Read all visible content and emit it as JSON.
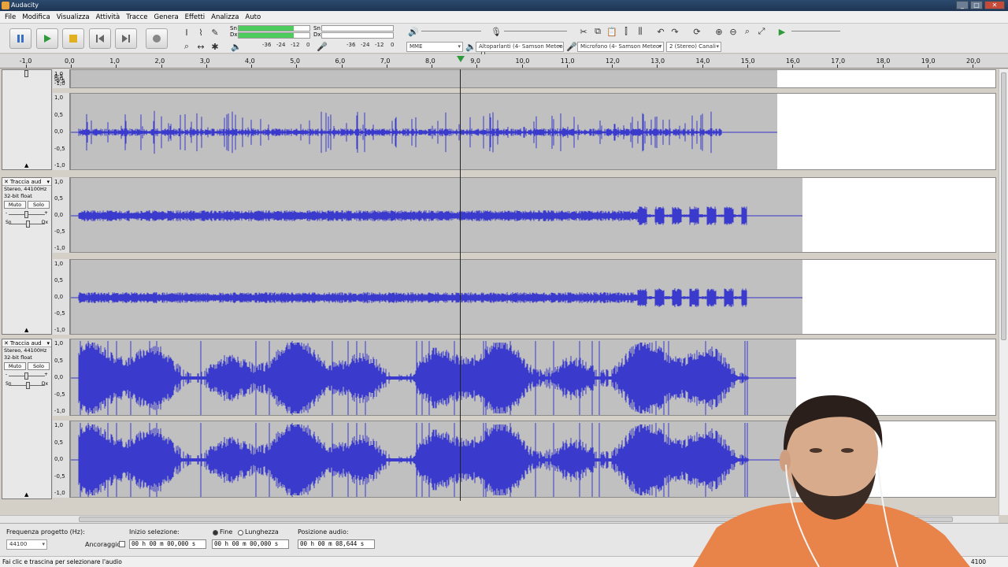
{
  "window": {
    "title": "Audacity"
  },
  "menu": [
    "File",
    "Modifica",
    "Visualizza",
    "Attività",
    "Tracce",
    "Genera",
    "Effetti",
    "Analizza",
    "Auto"
  ],
  "toolbar": {
    "meter_labels": [
      "Sn",
      "Dx",
      "Sn",
      "Dx"
    ],
    "meter_scale_play": [
      "-36",
      "-24",
      "-12",
      "0"
    ],
    "meter_scale_rec": [
      "-36",
      "-24",
      "-12",
      "0"
    ],
    "host": "MME",
    "output_device": "Altoparlanti (4- Samson Meteor",
    "input_device": "Microfono (4- Samson Meteor",
    "channels": "2 (Stereo) Canali"
  },
  "ruler": {
    "ticks": [
      "-1,0",
      "0,0",
      "1,0",
      "2,0",
      "3,0",
      "4,0",
      "5,0",
      "6,0",
      "7,0",
      "8,0",
      "9,0",
      "10,0",
      "11,0",
      "12,0",
      "13,0",
      "14,0",
      "15,0",
      "16,0",
      "17,0",
      "18,0",
      "19,0",
      "20,0"
    ]
  },
  "amp_ticks": [
    "1,0",
    "0,5",
    "0,0",
    "-0,5",
    "-1,0"
  ],
  "tracks": [
    {
      "name": "Traccia aud",
      "info1": "Stereo, 44100Hz",
      "info2": "32-bit float",
      "mute": "Muto",
      "solo": "Solo",
      "gain_left": "-",
      "gain_right": "+",
      "pan_left": "Sn",
      "pan_right": "Dx"
    },
    {
      "name": "Traccia aud",
      "info1": "Stereo, 44100Hz",
      "info2": "32-bit float",
      "mute": "Muto",
      "solo": "Solo",
      "gain_left": "-",
      "gain_right": "+",
      "pan_left": "Sn",
      "pan_right": "Dx"
    }
  ],
  "selection": {
    "rate_label": "Frequenza progetto (Hz):",
    "rate_value": "44100",
    "snap_label": "Ancoraggio",
    "start_label": "Inizio selezione:",
    "end_label": "Fine",
    "length_label": "Lunghezza",
    "position_label": "Posizione audio:",
    "start_value": "00 h 00 m 00,000 s",
    "end_value": "00 h 00 m 00,000 s",
    "position_value": "00 h 00 m 08,644 s"
  },
  "status": {
    "text": "Fai clic e trascina per selezionare l'audio",
    "right": "4100"
  },
  "colors": {
    "wave": "#3232c8",
    "clip": "#c0c0c0",
    "meter_green": "#4ccc5c"
  }
}
